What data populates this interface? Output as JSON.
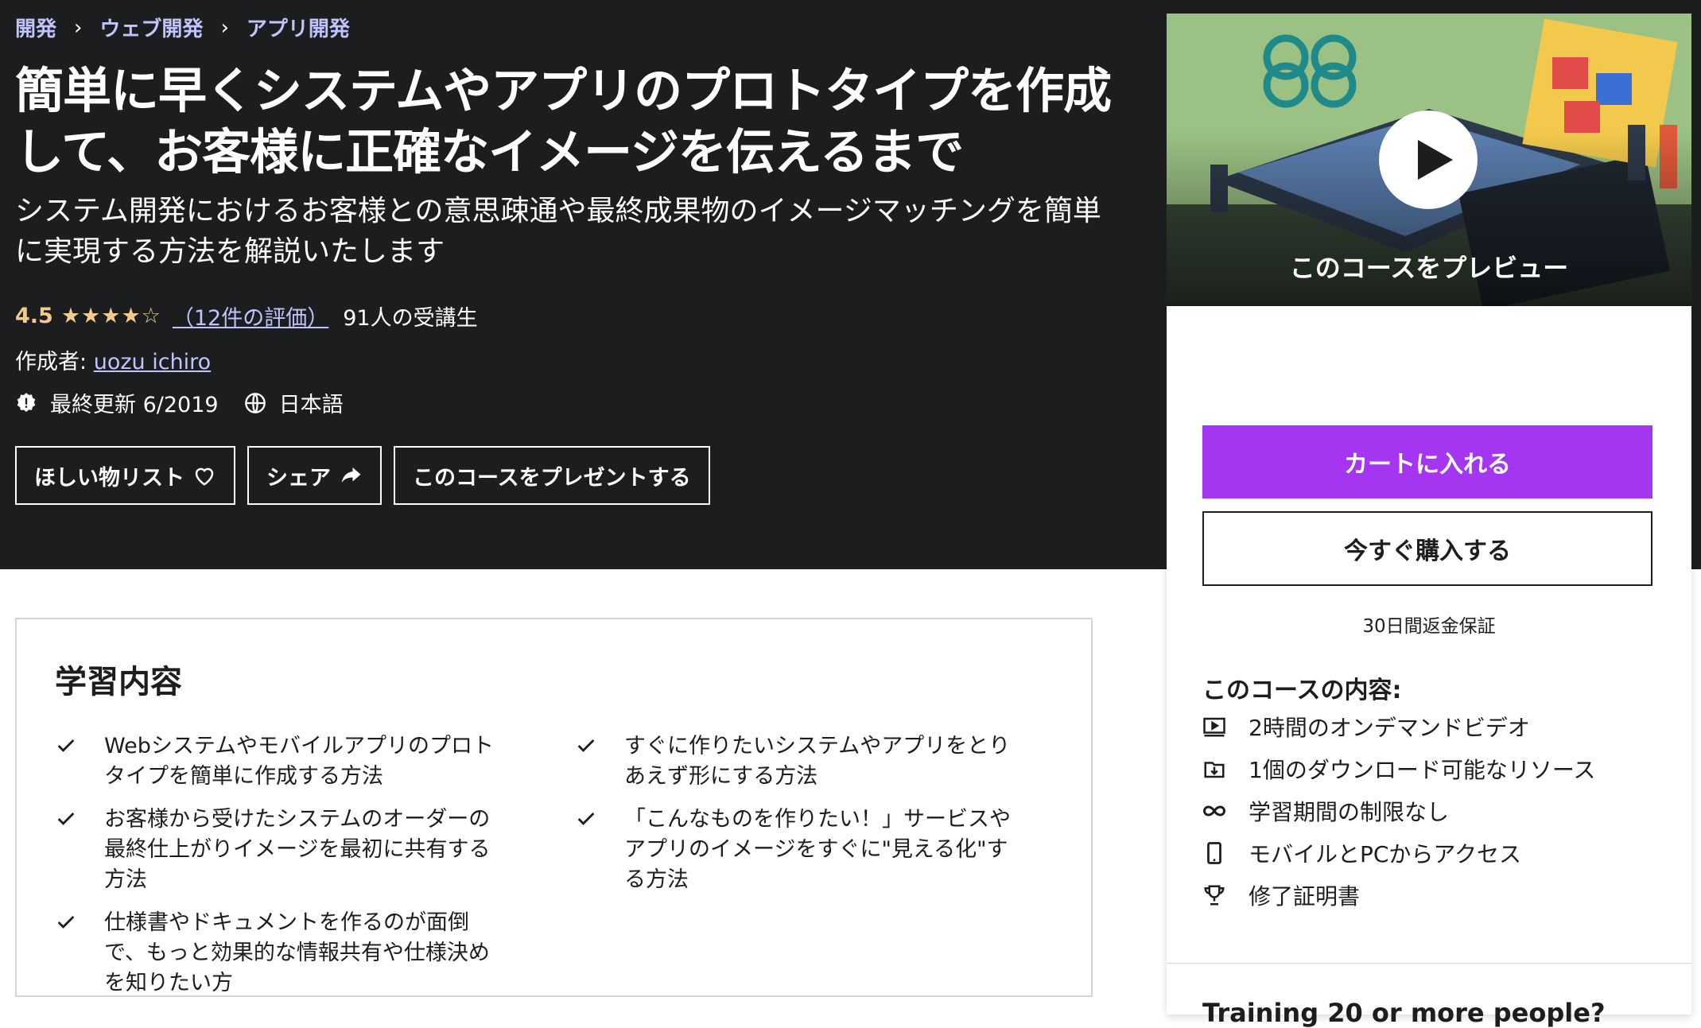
{
  "breadcrumb": [
    "開発",
    "ウェブ開発",
    "アプリ開発"
  ],
  "breadcrumb_sep": "›",
  "course": {
    "title": "簡単に早くシステムやアプリのプロトタイプを作成して、お客様に正確なイメージを伝えるまで",
    "subtitle": "システム開発におけるお客様との意思疎通や最終成果物のイメージマッチングを簡単に実現する方法を解説いたします",
    "rating": "4.5",
    "stars": "★★★★☆",
    "rating_count": "（12件の評価）",
    "students": "91人の受講生",
    "author_label": "作成者:",
    "author_name": "uozu ichiro",
    "updated": "最終更新 6/2019",
    "language": "日本語"
  },
  "actions": {
    "wishlist": "ほしい物リスト",
    "share": "シェア",
    "gift": "このコースをプレゼントする"
  },
  "preview": {
    "label": "このコースをプレビュー"
  },
  "purchase": {
    "add_to_cart": "カートに入れる",
    "buy_now": "今すぐ購入する",
    "guarantee": "30日間返金保証",
    "includes_title": "このコースの内容:",
    "includes": [
      {
        "icon": "video-icon",
        "text": "2時間のオンデマンドビデオ"
      },
      {
        "icon": "download-icon",
        "text": "1個のダウンロード可能なリソース"
      },
      {
        "icon": "infinity-icon",
        "text": "学習期間の制限なし"
      },
      {
        "icon": "mobile-icon",
        "text": "モバイルとPCからアクセス"
      },
      {
        "icon": "trophy-icon",
        "text": "修了証明書"
      }
    ],
    "training": "Training 20 or more people?"
  },
  "learn": {
    "title": "学習内容",
    "left": [
      "Webシステムやモバイルアプリのプロトタイプを簡単に作成する方法",
      "お客様から受けたシステムのオーダーの最終仕上がりイメージを最初に共有する方法",
      "仕様書やドキュメントを作るのが面倒で、もっと効果的な情報共有や仕様決めを知りたい方"
    ],
    "right": [
      "すぐに作りたいシステムやアプリをとりあえず形にする方法",
      "「こんなものを作りたい！」サービスやアプリのイメージをすぐに\"見える化\"する方法"
    ]
  },
  "colors": {
    "header_bg": "#1c1d1f",
    "link": "#c0c4fc",
    "star": "#f3ca8c",
    "primary": "#a435f0"
  }
}
